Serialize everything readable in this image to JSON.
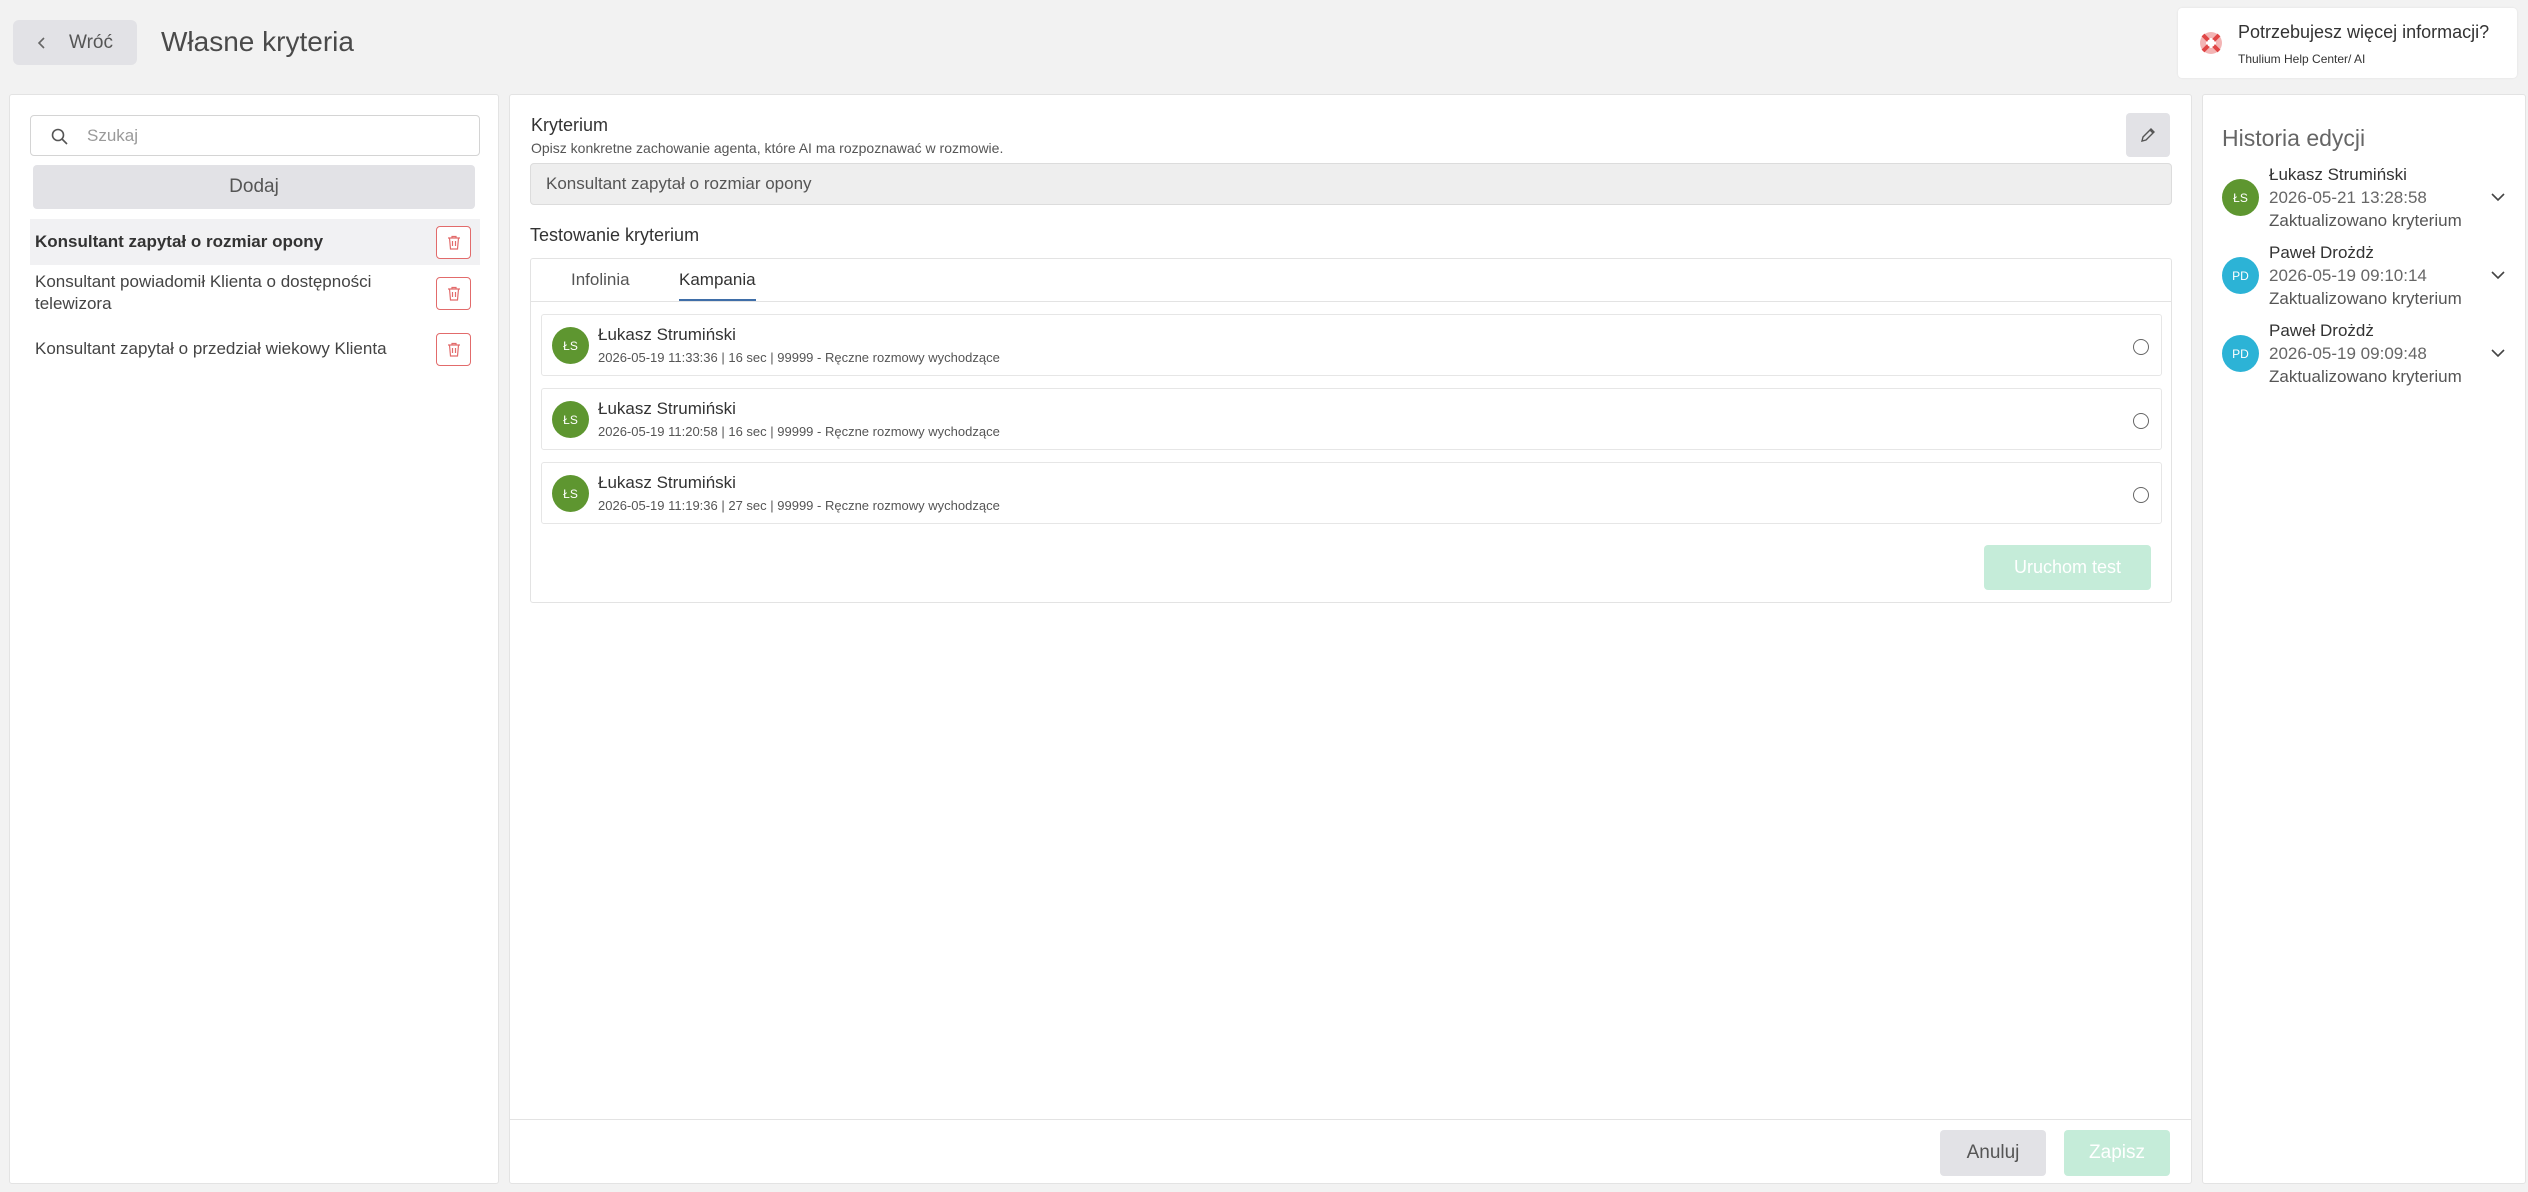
{
  "header": {
    "back_label": "Wróć",
    "page_title": "Własne kryteria"
  },
  "help": {
    "title": "Potrzebujesz więcej informacji?",
    "subtitle": "Thulium Help Center/ AI"
  },
  "sidebar": {
    "search_placeholder": "Szukaj",
    "add_label": "Dodaj",
    "items": [
      {
        "label": "Konsultant zapytał o rozmiar opony",
        "active": true
      },
      {
        "label": "Konsultant powiadomił Klienta o dostępności telewizora",
        "active": false
      },
      {
        "label": "Konsultant zapytał o przedział wiekowy Klienta",
        "active": false
      }
    ]
  },
  "criterion": {
    "header": "Kryterium",
    "description": "Opisz konkretne zachowanie agenta, które AI ma rozpoznawać w rozmowie.",
    "value": "Konsultant zapytał o rozmiar opony"
  },
  "testing": {
    "header": "Testowanie kryterium",
    "tabs": [
      {
        "label": "Infolinia",
        "active": false
      },
      {
        "label": "Kampania",
        "active": true
      }
    ],
    "conversations": [
      {
        "initials": "ŁS",
        "name": "Łukasz Strumiński",
        "meta": "2026-05-19 11:33:36 | 16 sec | 99999 - Ręczne rozmowy wychodzące"
      },
      {
        "initials": "ŁS",
        "name": "Łukasz Strumiński",
        "meta": "2026-05-19 11:20:58 | 16 sec | 99999 - Ręczne rozmowy wychodzące"
      },
      {
        "initials": "ŁS",
        "name": "Łukasz Strumiński",
        "meta": "2026-05-19 11:19:36 | 27 sec | 99999 - Ręczne rozmowy wychodzące"
      }
    ],
    "run_label": "Uruchom test"
  },
  "footer": {
    "cancel_label": "Anuluj",
    "save_label": "Zapisz"
  },
  "history": {
    "title": "Historia edycji",
    "items": [
      {
        "initials": "ŁS",
        "name": "Łukasz Strumiński",
        "date": "2026-05-21 13:28:58",
        "action": "Zaktualizowano kryterium",
        "color": "#5e9630"
      },
      {
        "initials": "PD",
        "name": "Paweł Drożdż",
        "date": "2026-05-19 09:10:14",
        "action": "Zaktualizowano kryterium",
        "color": "#2cb3d6"
      },
      {
        "initials": "PD",
        "name": "Paweł Drożdż",
        "date": "2026-05-19 09:09:48",
        "action": "Zaktualizowano kryterium",
        "color": "#2cb3d6"
      }
    ]
  },
  "colors": {
    "accent_tab": "#3f6ea8",
    "delete_red": "#e26b6b",
    "disabled_green": "#c5ecd9"
  }
}
